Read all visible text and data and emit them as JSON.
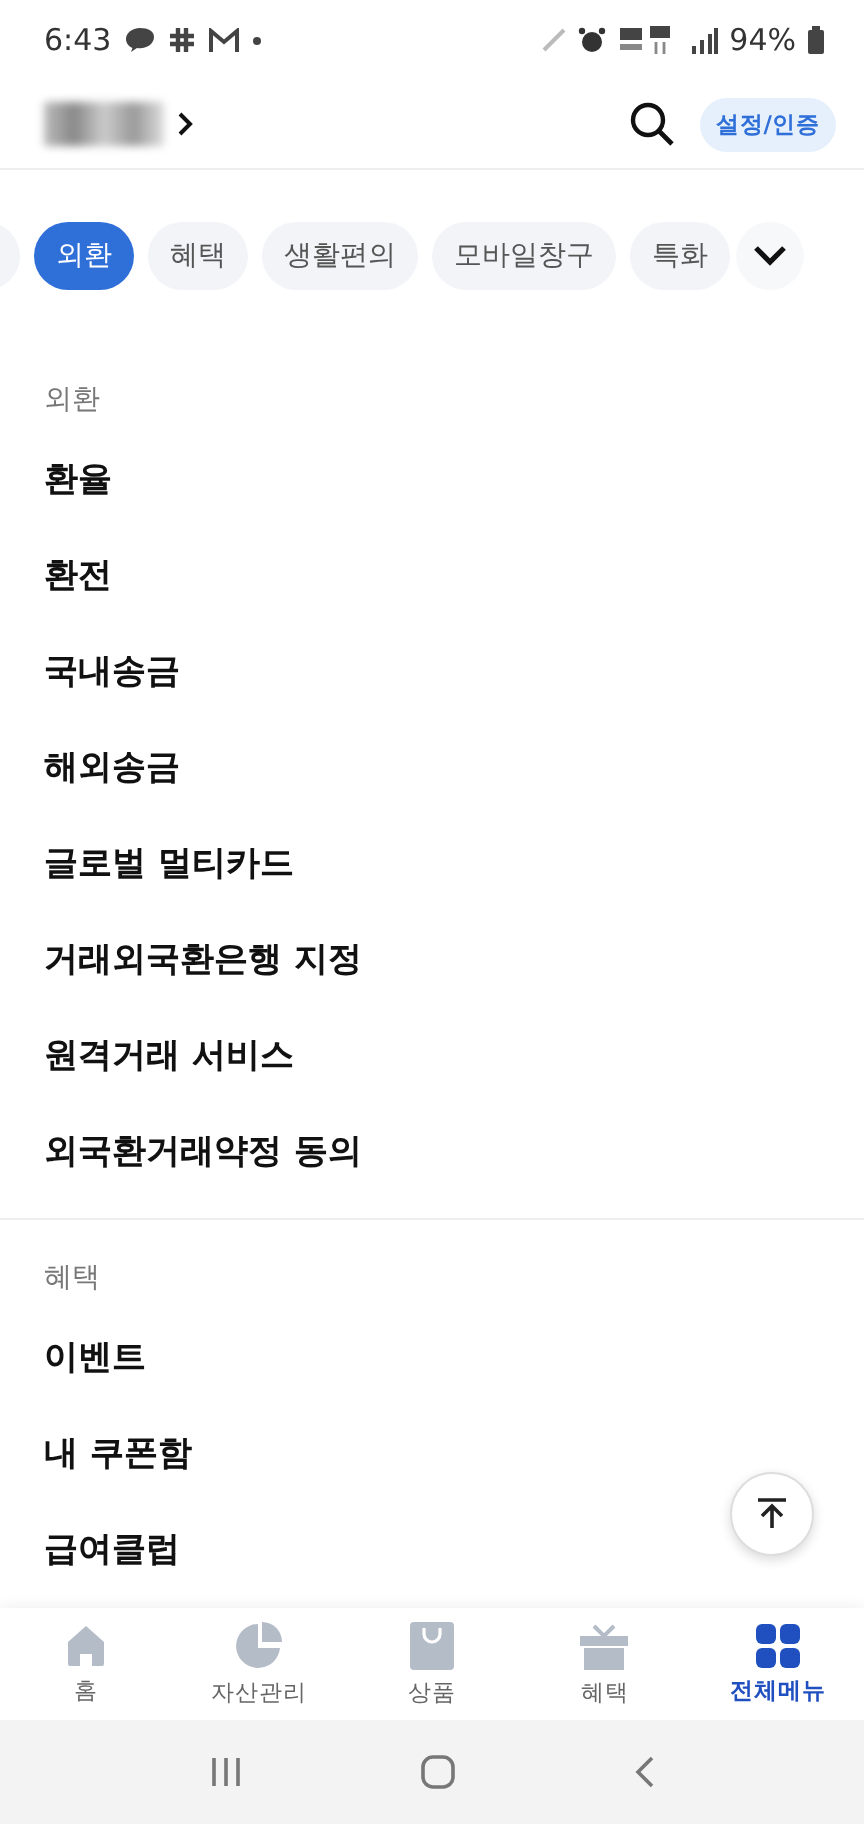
{
  "status_bar": {
    "time": "6:43",
    "battery": "94%"
  },
  "header": {
    "settings_button": "설정/인증"
  },
  "chips": [
    {
      "label": "외환",
      "selected": true
    },
    {
      "label": "혜택",
      "selected": false
    },
    {
      "label": "생활편의",
      "selected": false
    },
    {
      "label": "모바일창구",
      "selected": false
    },
    {
      "label": "특화",
      "selected": false
    }
  ],
  "sections": [
    {
      "title": "외환",
      "items": [
        "환율",
        "환전",
        "국내송금",
        "해외송금",
        "글로벌 멀티카드",
        "거래외국환은행 지정",
        "원격거래 서비스",
        "외국환거래약정 동의"
      ]
    },
    {
      "title": "혜택",
      "items": [
        "이벤트",
        "내 쿠폰함",
        "급여클럽"
      ]
    }
  ],
  "bottom_nav": [
    {
      "label": "홈",
      "kind": "home",
      "selected": false
    },
    {
      "label": "자산관리",
      "kind": "assets",
      "selected": false
    },
    {
      "label": "상품",
      "kind": "products",
      "selected": false
    },
    {
      "label": "혜택",
      "kind": "benefits",
      "selected": false
    },
    {
      "label": "전체메뉴",
      "kind": "menu",
      "selected": true
    }
  ]
}
